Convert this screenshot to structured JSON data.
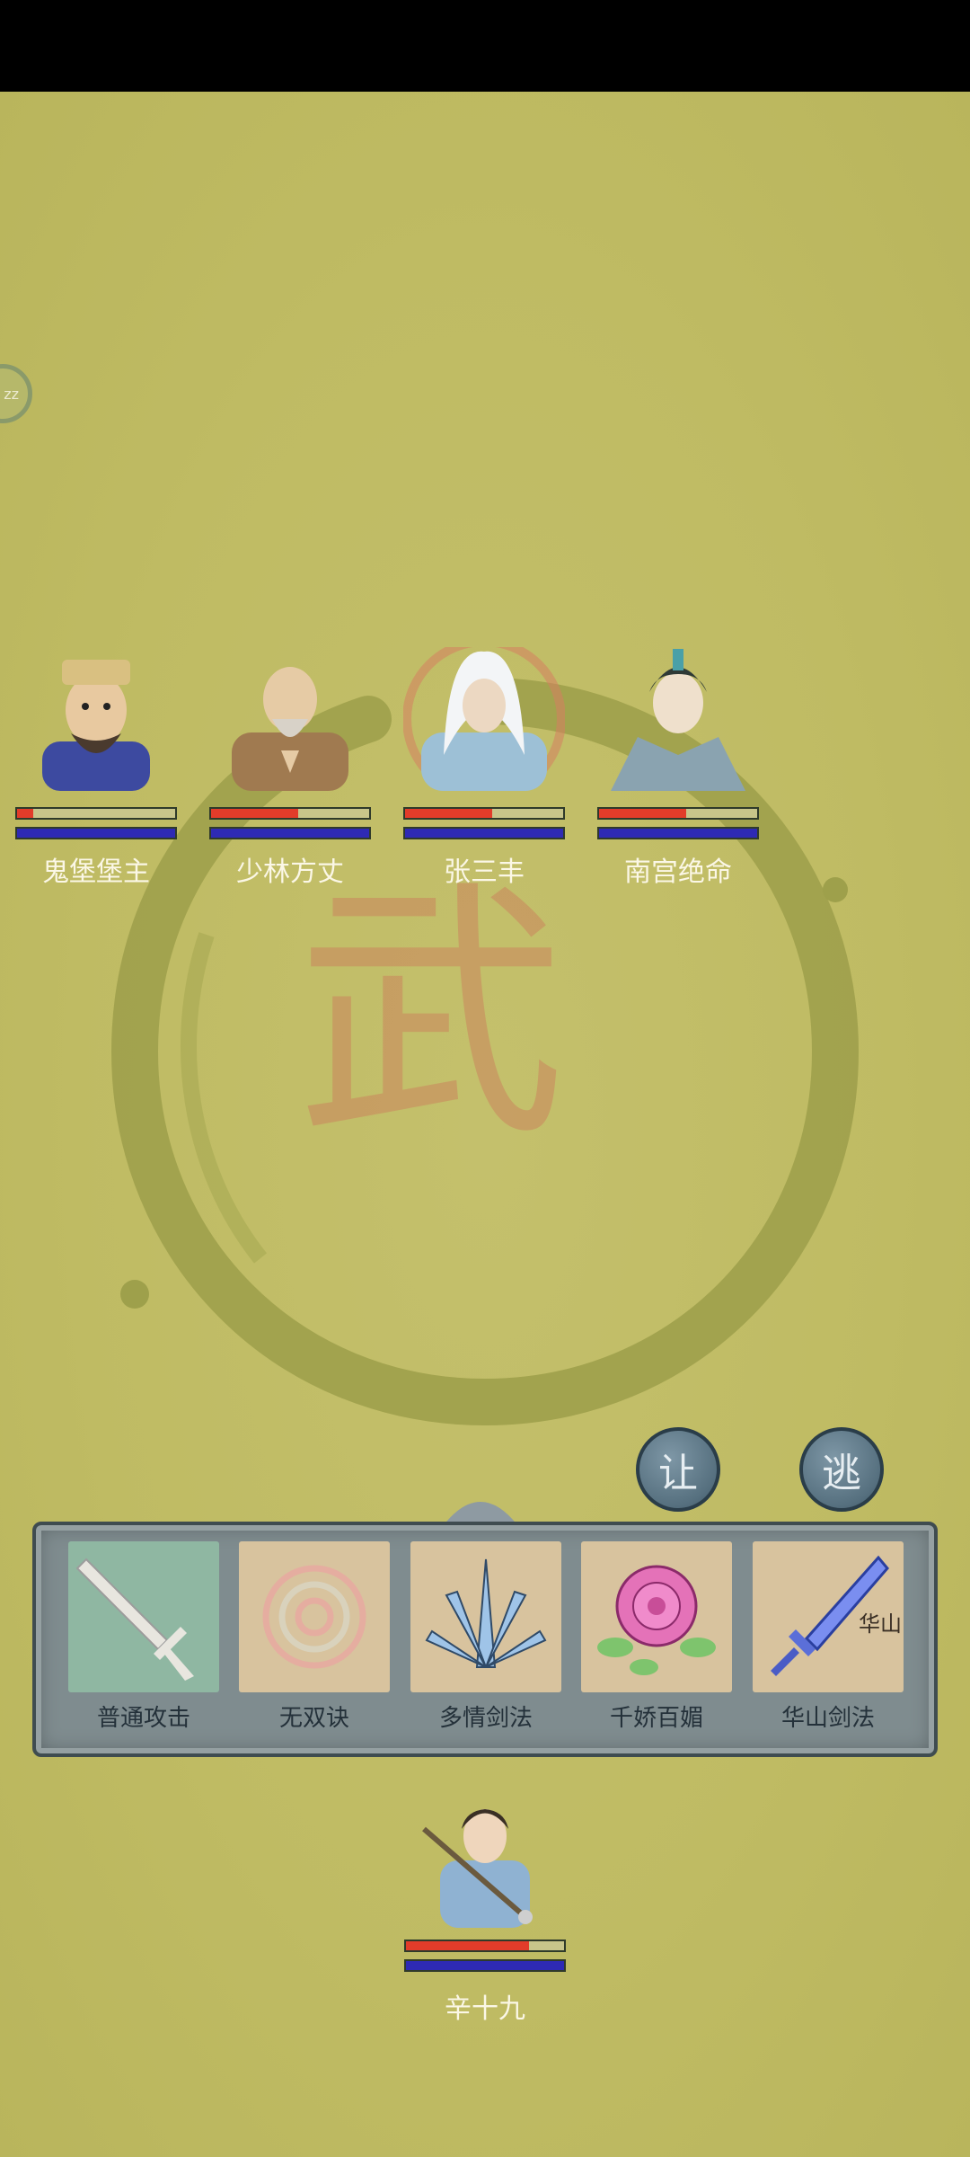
{
  "enemies": [
    {
      "name": "鬼堡堡主",
      "hp": 0.1,
      "mp": 1.0
    },
    {
      "name": "少林方丈",
      "hp": 0.55,
      "mp": 1.0
    },
    {
      "name": "张三丰",
      "hp": 0.55,
      "mp": 1.0
    },
    {
      "name": "南宫绝命",
      "hp": 0.55,
      "mp": 1.0
    }
  ],
  "background_glyph": "武",
  "sleep_button": "zz",
  "action_buttons": {
    "yield": "让",
    "flee": "逃"
  },
  "skills": [
    {
      "label": "普通攻击",
      "icon": "sword-icon"
    },
    {
      "label": "无双诀",
      "icon": "spiral-icon"
    },
    {
      "label": "多情剑法",
      "icon": "blades-fan-icon"
    },
    {
      "label": "千娇百媚",
      "icon": "rose-icon"
    },
    {
      "label": "华山剑法",
      "icon": "blue-sword-icon",
      "badge": "华山"
    }
  ],
  "player": {
    "name": "辛十九",
    "hp": 0.78,
    "mp": 1.0
  },
  "colors": {
    "hp": "#e23c2a",
    "mp": "#2e2ab4",
    "background": "#c1bd66",
    "panel": "#7f8c8f"
  }
}
